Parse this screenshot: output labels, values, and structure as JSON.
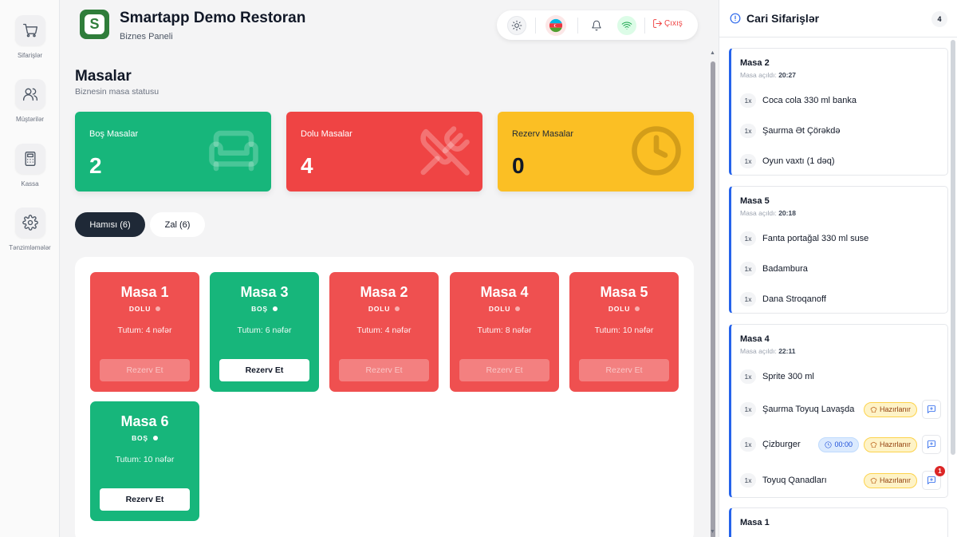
{
  "nav": [
    {
      "label": "Sifarişlər",
      "icon": "cart-icon"
    },
    {
      "label": "Müştərilər",
      "icon": "users-icon"
    },
    {
      "label": "Kassa",
      "icon": "calculator-icon"
    },
    {
      "label": "Tənzimləmələr",
      "icon": "gear-icon"
    }
  ],
  "header": {
    "logo_letter": "S",
    "title": "Smartapp Demo Restoran",
    "subtitle": "Biznes Paneli",
    "logout_label": "Çıxış"
  },
  "page": {
    "title": "Masalar",
    "subtitle": "Biznesin masa statusu"
  },
  "stats": [
    {
      "label": "Boş Masalar",
      "value": "2",
      "color": "#17b67b",
      "icon": "sofa-icon"
    },
    {
      "label": "Dolu Masalar",
      "value": "4",
      "color": "#ef4444",
      "icon": "utensils-icon"
    },
    {
      "label": "Rezerv Masalar",
      "value": "0",
      "color": "#fbbf24",
      "icon": "clock-icon"
    }
  ],
  "filters": [
    {
      "label": "Hamısı (6)",
      "active": true
    },
    {
      "label": "Zal (6)",
      "active": false
    }
  ],
  "tables": [
    {
      "name": "Masa 1",
      "status": "DOLU",
      "capacity": "Tutum: 4 nəfər",
      "button": "Rezerv Et",
      "state": "red"
    },
    {
      "name": "Masa 3",
      "status": "BOŞ",
      "capacity": "Tutum: 6 nəfər",
      "button": "Rezerv Et",
      "state": "green"
    },
    {
      "name": "Masa 2",
      "status": "DOLU",
      "capacity": "Tutum: 4 nəfər",
      "button": "Rezerv Et",
      "state": "red"
    },
    {
      "name": "Masa 4",
      "status": "DOLU",
      "capacity": "Tutum: 8 nəfər",
      "button": "Rezerv Et",
      "state": "red"
    },
    {
      "name": "Masa 5",
      "status": "DOLU",
      "capacity": "Tutum: 10 nəfər",
      "button": "Rezerv Et",
      "state": "red"
    },
    {
      "name": "Masa 6",
      "status": "BOŞ",
      "capacity": "Tutum: 10 nəfər",
      "button": "Rezerv Et",
      "state": "green"
    }
  ],
  "orders_panel": {
    "title": "Cari Sifarişlər",
    "count": "4",
    "opened_label": "Masa açıldı:",
    "orders": [
      {
        "table": "Masa 2",
        "time": "20:27",
        "items": [
          {
            "qty": "1x",
            "name": "Coca cola 330 ml banka"
          },
          {
            "qty": "1x",
            "name": "Şaurma Ət Çörəkdə"
          },
          {
            "qty": "1x",
            "name": "Oyun vaxtı (1 dəq)"
          }
        ]
      },
      {
        "table": "Masa 5",
        "time": "20:18",
        "items": [
          {
            "qty": "1x",
            "name": "Fanta portağal 330 ml suse"
          },
          {
            "qty": "1x",
            "name": "Badambura"
          },
          {
            "qty": "1x",
            "name": "Dana Stroqanoff"
          }
        ]
      },
      {
        "table": "Masa 4",
        "time": "22:11",
        "items": [
          {
            "qty": "1x",
            "name": "Sprite 300 ml"
          },
          {
            "qty": "1x",
            "name": "Şaurma Toyuq Lavaşda",
            "status": "Hazırlanır"
          },
          {
            "qty": "1x",
            "name": "Çizburger",
            "timer": "00:00",
            "status": "Hazırlanır"
          },
          {
            "qty": "1x",
            "name": "Toyuq Qanadları",
            "status": "Hazırlanır",
            "notes": "1"
          }
        ]
      },
      {
        "table": "Masa 1"
      }
    ]
  }
}
